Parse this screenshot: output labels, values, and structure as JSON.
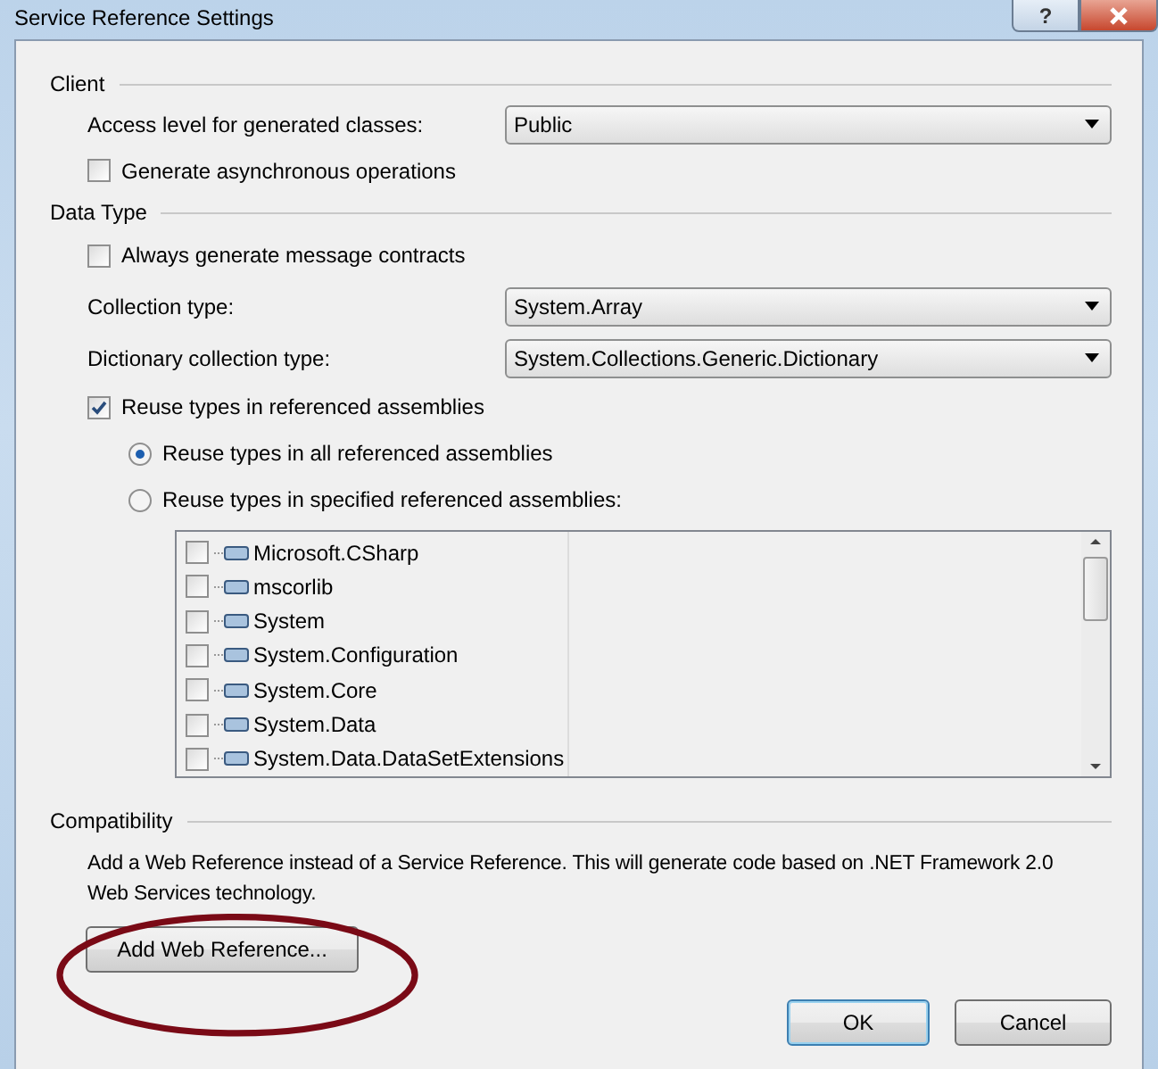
{
  "window": {
    "title": "Service Reference Settings",
    "help": "?"
  },
  "client": {
    "heading": "Client",
    "access_level": {
      "label": "Access level for generated classes:",
      "value": "Public"
    },
    "generate_async": {
      "label": "Generate asynchronous operations",
      "checked": false
    }
  },
  "data_type": {
    "heading": "Data Type",
    "message_contracts": {
      "label": "Always generate message contracts",
      "checked": false
    },
    "collection_type": {
      "label": "Collection type:",
      "value": "System.Array"
    },
    "dictionary_type": {
      "label": "Dictionary collection type:",
      "value": "System.Collections.Generic.Dictionary"
    },
    "reuse_types": {
      "label": "Reuse types in referenced assemblies",
      "checked": true
    },
    "reuse_options": [
      {
        "label": "Reuse types in all referenced assemblies",
        "selected": true
      },
      {
        "label": "Reuse types in specified referenced assemblies:",
        "selected": false
      }
    ],
    "assemblies": [
      {
        "name": "Microsoft.CSharp",
        "checked": false
      },
      {
        "name": "mscorlib",
        "checked": false
      },
      {
        "name": "System",
        "checked": false
      },
      {
        "name": "System.Configuration",
        "checked": false
      },
      {
        "name": "System.Core",
        "checked": false
      },
      {
        "name": "System.Data",
        "checked": false
      },
      {
        "name": "System.Data.DataSetExtensions",
        "checked": false
      }
    ]
  },
  "compatibility": {
    "heading": "Compatibility",
    "description": "Add a Web Reference instead of a Service Reference. This will generate code based on .NET Framework 2.0 Web Services technology.",
    "button": "Add Web Reference..."
  },
  "buttons": [
    {
      "label": "OK",
      "default": true
    },
    {
      "label": "Cancel",
      "default": false
    }
  ]
}
